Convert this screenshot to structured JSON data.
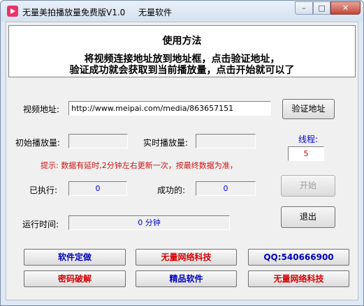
{
  "window": {
    "title": "无量美拍播放量免费版V1.0",
    "subtitle": "无量软件",
    "minimize": "–",
    "maximize": "□",
    "close": "✕"
  },
  "banner": {
    "heading": "使用方法",
    "line1": "将视频连接地址放到地址框，点击验证地址，",
    "line2": "验证成功就会获取到当前播放量，点击开始就可以了"
  },
  "form": {
    "video_url_label": "视频地址:",
    "video_url_value": "http://www.meipai.com/media/863657151",
    "verify_button": "验证地址",
    "initial_plays_label": "初始播放量:",
    "initial_plays_value": "",
    "realtime_plays_label": "实时播放量:",
    "realtime_plays_value": "",
    "threads_label": "线程:",
    "threads_value": "5",
    "tip": "提示: 数据有延时,2分钟左右更新一次，按最终数据为准，",
    "executed_label": "已执行:",
    "executed_value": "0",
    "success_label": "成功的:",
    "success_value": "0",
    "start_button": "开始",
    "exit_button": "退出",
    "runtime_label": "运行时间:",
    "runtime_value": "0 分钟"
  },
  "bottom_buttons": {
    "custom_software": "软件定做",
    "wuliang_tech_1": "无量网络科技",
    "qq": "QQ:540666900",
    "password_crack": "密码破解",
    "premium_software": "精品软件",
    "wuliang_tech_2": "无量网络科技"
  },
  "colors": {
    "tip_red": "#d11010",
    "link_blue": "#0000bb",
    "brand_red": "#d40000"
  }
}
